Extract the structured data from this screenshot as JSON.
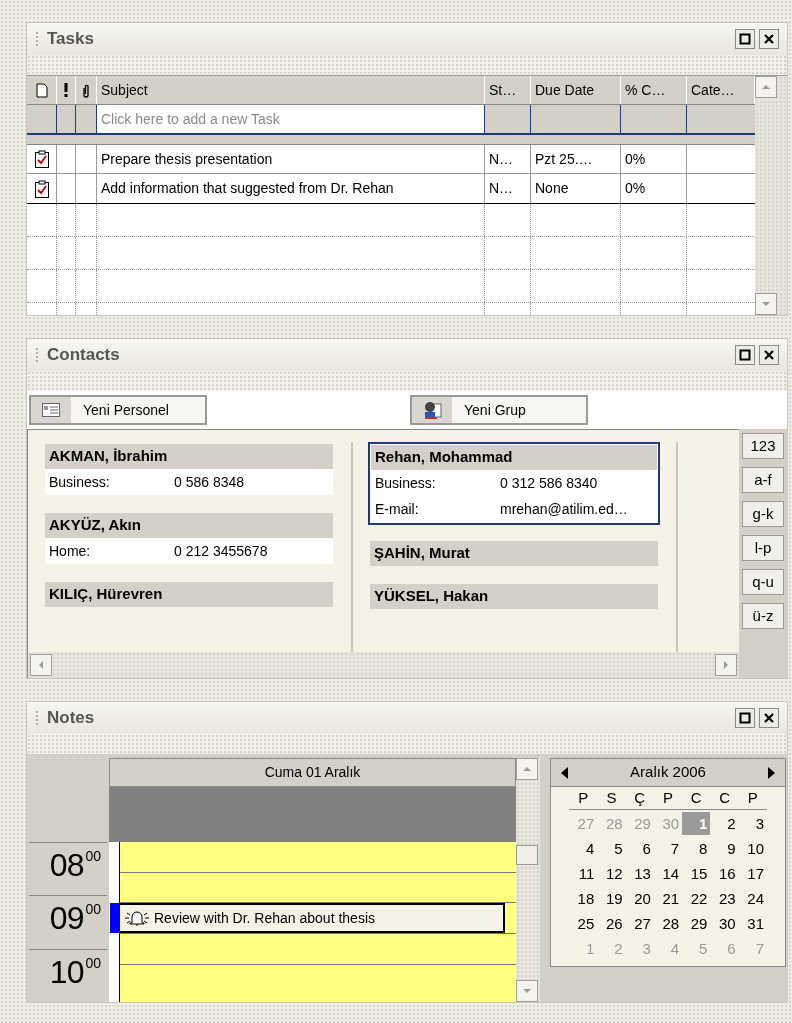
{
  "tasks": {
    "title": "Tasks",
    "columns": [
      "Subject",
      "St…",
      "Due Date",
      "% C…",
      "Cate…"
    ],
    "new_task": {
      "placeholder": "Click here to add a new Task"
    },
    "rows": [
      {
        "subject": "Prepare thesis presentation",
        "status": "N…",
        "due_date": "Pzt 25.…",
        "percent": "0%"
      },
      {
        "subject": "Add  information that suggested from Dr. Rehan",
        "status": "N…",
        "due_date": "None",
        "percent": "0%"
      }
    ]
  },
  "contacts": {
    "title": "Contacts",
    "buttons": [
      {
        "label": "Yeni Personel",
        "kind": "card"
      },
      {
        "label": "Yeni Grup",
        "kind": "group"
      }
    ],
    "columns": [
      [
        {
          "name": "AKMAN, İbrahim",
          "selected": false,
          "fields": [
            {
              "label": "Business:",
              "value": "0 586 8348"
            }
          ]
        },
        {
          "name": "AKYÜZ, Akın",
          "selected": false,
          "fields": [
            {
              "label": "Home:",
              "value": "0 212 3455678"
            }
          ]
        },
        {
          "name": "KILIÇ, Hürevren",
          "selected": false
        }
      ],
      [
        {
          "name": "Rehan, Mohammad",
          "selected": true,
          "fields": [
            {
              "label": "Business:",
              "value": "0 312 586 8340"
            },
            {
              "label": "E-mail:",
              "value": "mrehan@atilim.ed…"
            }
          ]
        },
        {
          "name": "ŞAHİN, Murat",
          "selected": false
        },
        {
          "name": "YÜKSEL, Hakan",
          "selected": false
        }
      ]
    ],
    "index": [
      "123",
      "a-f",
      "g-k",
      "l-p",
      "q-u",
      "ü-z"
    ]
  },
  "notes": {
    "title": "Notes",
    "day_header": "Cuma 01 Aralık",
    "hours": [
      {
        "hour": "08",
        "minutes": "00"
      },
      {
        "hour": "09",
        "minutes": "00"
      },
      {
        "hour": "10",
        "minutes": "00"
      }
    ],
    "appointment": {
      "text": "Review with Dr. Rehan about thesis"
    },
    "calendar": {
      "month": "Aralık 2006",
      "weekdays": [
        "P",
        "S",
        "Ç",
        "P",
        "C",
        "C",
        "P"
      ],
      "weeks": [
        [
          {
            "day": "27",
            "muted": true,
            "selected": false
          },
          {
            "day": "28",
            "muted": true,
            "selected": false
          },
          {
            "day": "29",
            "muted": true,
            "selected": false
          },
          {
            "day": "30",
            "muted": true,
            "selected": false
          },
          {
            "day": "1",
            "muted": false,
            "selected": true
          },
          {
            "day": "2",
            "muted": false,
            "selected": false
          },
          {
            "day": "3",
            "muted": false,
            "selected": false
          }
        ],
        [
          {
            "day": "4",
            "muted": false,
            "selected": false
          },
          {
            "day": "5",
            "muted": false,
            "selected": false
          },
          {
            "day": "6",
            "muted": false,
            "selected": false
          },
          {
            "day": "7",
            "muted": false,
            "selected": false
          },
          {
            "day": "8",
            "muted": false,
            "selected": false
          },
          {
            "day": "9",
            "muted": false,
            "selected": false
          },
          {
            "day": "10",
            "muted": false,
            "selected": false
          }
        ],
        [
          {
            "day": "11",
            "muted": false,
            "selected": false
          },
          {
            "day": "12",
            "muted": false,
            "selected": false
          },
          {
            "day": "13",
            "muted": false,
            "selected": false
          },
          {
            "day": "14",
            "muted": false,
            "selected": false
          },
          {
            "day": "15",
            "muted": false,
            "selected": false
          },
          {
            "day": "16",
            "muted": false,
            "selected": false
          },
          {
            "day": "17",
            "muted": false,
            "selected": false
          }
        ],
        [
          {
            "day": "18",
            "muted": false,
            "selected": false
          },
          {
            "day": "19",
            "muted": false,
            "selected": false
          },
          {
            "day": "20",
            "muted": false,
            "selected": false
          },
          {
            "day": "21",
            "muted": false,
            "selected": false
          },
          {
            "day": "22",
            "muted": false,
            "selected": false
          },
          {
            "day": "23",
            "muted": false,
            "selected": false
          },
          {
            "day": "24",
            "muted": false,
            "selected": false
          }
        ],
        [
          {
            "day": "25",
            "muted": false,
            "selected": false
          },
          {
            "day": "26",
            "muted": false,
            "selected": false
          },
          {
            "day": "27",
            "muted": false,
            "selected": false
          },
          {
            "day": "28",
            "muted": false,
            "selected": false
          },
          {
            "day": "29",
            "muted": false,
            "selected": false
          },
          {
            "day": "30",
            "muted": false,
            "selected": false
          },
          {
            "day": "31",
            "muted": false,
            "selected": false
          }
        ],
        [
          {
            "day": "1",
            "muted": true,
            "selected": false
          },
          {
            "day": "2",
            "muted": true,
            "selected": false
          },
          {
            "day": "3",
            "muted": true,
            "selected": false
          },
          {
            "day": "4",
            "muted": true,
            "selected": false
          },
          {
            "day": "5",
            "muted": true,
            "selected": false
          },
          {
            "day": "6",
            "muted": true,
            "selected": false
          },
          {
            "day": "7",
            "muted": true,
            "selected": false
          }
        ]
      ]
    }
  }
}
